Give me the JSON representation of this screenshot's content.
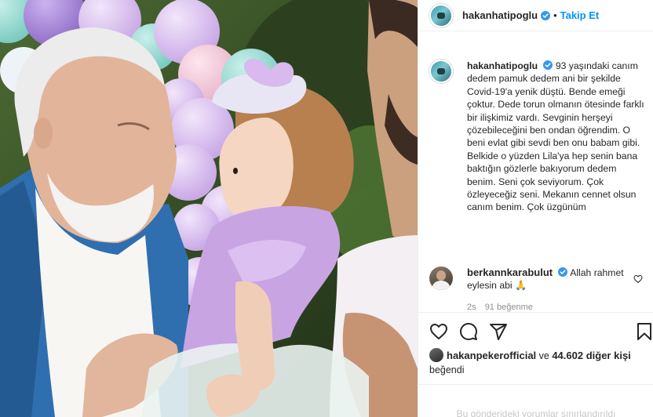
{
  "post": {
    "username": "hakanhatipoglu",
    "follow_label": "Takip Et",
    "separator": "•",
    "caption": "93 yaşındaki canım dedem pamuk dedem ani bir şekilde Covid-19'a yenik düştü. Bende emeği çoktur. Dede torun olmanın ötesinde farklı bir ilişkimiz vardı. Sevginin herşeyi çözebileceğini ben ondan öğrendim. O beni evlat gibi sevdi ben onu babam gibi. Belkide o yüzden Lila'ya hep senin bana baktığın gözlerle bakıyorum dedem benim. Seni çok seviyorum. Çok özleyeceğiz seni. Mekanın cennet olsun canım benim. Çok üzgünüm"
  },
  "comment": {
    "username": "berkannkarabulut",
    "text": "Allah rahmet eylesin abi",
    "emoji": "🙏",
    "time": "2s",
    "likes": "91 beğenme"
  },
  "likes": {
    "user": "hakanpekerofficial",
    "connector": "ve",
    "count": "44.602 diğer kişi",
    "suffix": "beğendi"
  },
  "footer": {
    "comments_disabled": "Bu gönderideki yorumlar sınırlandırıldı"
  },
  "icons": {
    "verified": "verified-badge-icon",
    "like": "heart-icon",
    "comment": "comment-icon",
    "share": "share-icon",
    "save": "bookmark-icon"
  },
  "colors": {
    "link_blue": "#0095f6",
    "verified_blue": "#3897f0",
    "text": "#262626",
    "muted": "#8e8e8e"
  }
}
